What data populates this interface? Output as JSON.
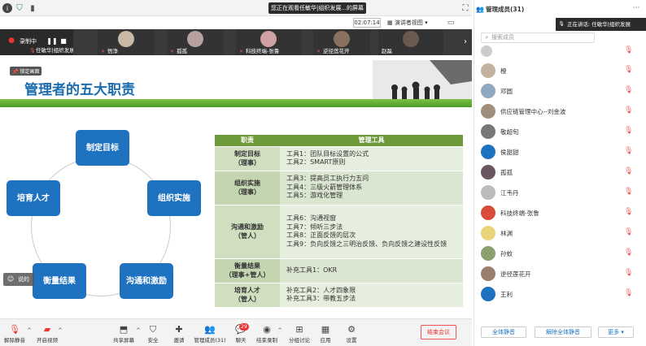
{
  "topbar": {
    "share_banner": "您正在观看任敏华|组织发展...的屏幕",
    "timer": "02:07:14",
    "view_label": "演讲者视图"
  },
  "strip": {
    "recording_label": "录制中",
    "lock_label": "锁定画面",
    "participants": [
      {
        "name": "任敏华|组织发展..."
      },
      {
        "name": "悟净"
      },
      {
        "name": "孤孤"
      },
      {
        "name": "科技终端-张鲁"
      },
      {
        "name": "逆径莲花开"
      },
      {
        "name": "赵磊"
      }
    ]
  },
  "slide": {
    "title": "管理者的五大职责",
    "nodes": [
      "制定目标",
      "组织实施",
      "沟通和激励",
      "衡量结果",
      "培育人才"
    ],
    "table": {
      "headers": [
        "职责",
        "管理工具"
      ],
      "rows": [
        {
          "duty": "制定目标\n（理事）",
          "tools": "工具1：团队目标设置的公式\n工具2：SMART原则"
        },
        {
          "duty": "组织实施\n（理事）",
          "tools": "工具3：提高员工执行力五问\n工具4：三级火箭管理体系\n工具5：游戏化管理"
        },
        {
          "duty": "沟通和激励\n（管人）",
          "tools": "工具6：沟通视窗\n工具7：倾听三步法\n工具8：正面反馈的层次\n工具9：负向反馈之三明治反馈、负向反馈之建设性反馈"
        },
        {
          "duty": "衡量结果\n（理事+管人）",
          "tools": "补充工具1：OKR"
        },
        {
          "duty": "培育人才\n（管人）",
          "tools": "补充工具2：人才四象限\n补充工具3：带教五步法"
        }
      ]
    },
    "overlay_label": "说的"
  },
  "toolbar": {
    "items": [
      {
        "label": "解除静音",
        "icon": "mic-off-icon"
      },
      {
        "label": "开启视频",
        "icon": "camera-off-icon"
      },
      {
        "label": "共享屏幕",
        "icon": "share-screen-icon"
      },
      {
        "label": "安全",
        "icon": "shield-icon"
      },
      {
        "label": "邀请",
        "icon": "invite-icon"
      },
      {
        "label": "管理成员(31)",
        "icon": "members-icon"
      },
      {
        "label": "聊天",
        "icon": "chat-icon"
      },
      {
        "label": "结束录制",
        "icon": "record-icon"
      },
      {
        "label": "分组讨论",
        "icon": "breakout-icon"
      },
      {
        "label": "应用",
        "icon": "apps-icon"
      },
      {
        "label": "设置",
        "icon": "settings-icon"
      }
    ],
    "chat_badge": "29",
    "end_meeting": "结束会议"
  },
  "panel": {
    "title": "管理成员(31)",
    "speaking": "正在讲话: 任敏华|组织发展",
    "search_placeholder": "搜索成员",
    "members": [
      "橙",
      "邓圆",
      "供应链管理中心--刘金波",
      "敬超旬",
      "侯甜甜",
      "孤孤",
      "江韦丹",
      "科技终端-张鲁",
      "林渊",
      "孙蚊",
      "逆径莲花开",
      "王利"
    ],
    "btn_mute_all": "全体静音",
    "btn_unmute_all": "解除全体静音",
    "btn_more": "更多"
  },
  "colors": {
    "accent": "#1f72c0",
    "slide_green": "#6d9a3b",
    "alert": "#e33"
  }
}
